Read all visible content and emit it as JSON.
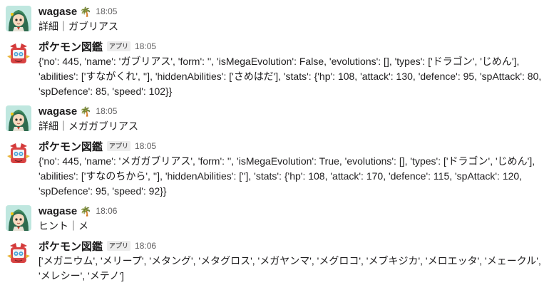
{
  "messages": [
    {
      "sender": "wagase",
      "badge_icon": "palm-tree-emoji",
      "badge_glyph": "🌴",
      "time": "18:05",
      "text": "詳細｜ガブリアス"
    },
    {
      "sender": "ポケモン図鑑",
      "app_label": "アプリ",
      "time": "18:05",
      "text": "{'no': 445, 'name': 'ガブリアス', 'form': '', 'isMegaEvolution': False, 'evolutions': [], 'types': ['ドラゴン', 'じめん'], 'abilities': ['すながくれ', ''], 'hiddenAbilities': ['さめはだ'], 'stats': {'hp': 108, 'attack': 130, 'defence': 95, 'spAttack': 80, 'spDefence': 85, 'speed': 102}}"
    },
    {
      "sender": "wagase",
      "badge_icon": "palm-tree-emoji",
      "badge_glyph": "🌴",
      "time": "18:05",
      "text": "詳細｜メガガブリアス"
    },
    {
      "sender": "ポケモン図鑑",
      "app_label": "アプリ",
      "time": "18:05",
      "text": "{'no': 445, 'name': 'メガガブリアス', 'form': '', 'isMegaEvolution': True, 'evolutions': [], 'types': ['ドラゴン', 'じめん'], 'abilities': ['すなのちから', ''], 'hiddenAbilities': [''], 'stats': {'hp': 108, 'attack': 170, 'defence': 115, 'spAttack': 120, 'spDefence': 95, 'speed': 92}}"
    },
    {
      "sender": "wagase",
      "badge_icon": "palm-tree-emoji",
      "badge_glyph": "🌴",
      "time": "18:06",
      "text": "ヒント｜メ"
    },
    {
      "sender": "ポケモン図鑑",
      "app_label": "アプリ",
      "time": "18:06",
      "text": "['メガニウム', 'メリープ', 'メタング', 'メタグロス', 'メガヤンマ', 'メグロコ', 'メブキジカ', 'メロエッタ', 'メェークル', 'メレシー', 'メテノ']"
    }
  ]
}
